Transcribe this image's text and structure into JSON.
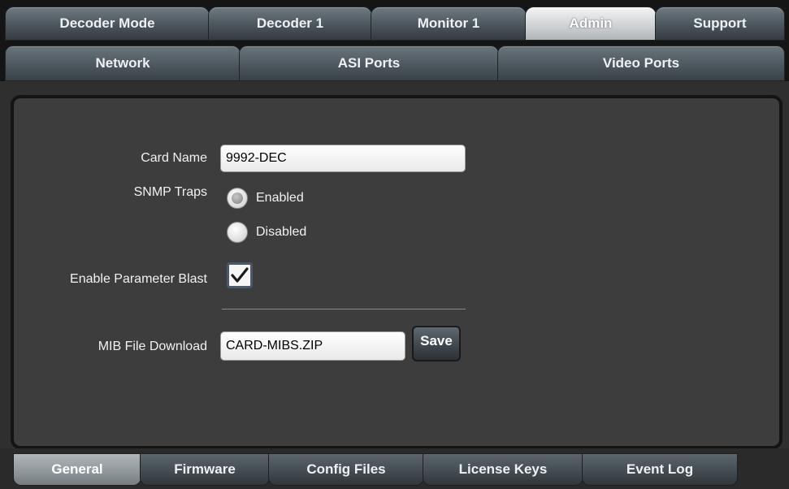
{
  "top_tabs": {
    "decoder_mode": "Decoder Mode",
    "decoder_1": "Decoder 1",
    "monitor_1": "Monitor 1",
    "admin": "Admin",
    "support": "Support"
  },
  "sub_tabs": {
    "network": "Network",
    "asi_ports": "ASI Ports",
    "video_ports": "Video Ports"
  },
  "form": {
    "card_name_label": "Card Name",
    "card_name_value": "9992-DEC",
    "snmp_traps_label": "SNMP Traps",
    "snmp_enabled_label": "Enabled",
    "snmp_disabled_label": "Disabled",
    "snmp_selected": "Enabled",
    "param_blast_label": "Enable Parameter Blast",
    "param_blast_checked": true,
    "mib_label": "MIB File Download",
    "mib_value": "CARD-MIBS.ZIP",
    "save_label": "Save"
  },
  "bottom_tabs": {
    "general": "General",
    "firmware": "Firmware",
    "config_files": "Config Files",
    "license_keys": "License Keys",
    "event_log": "Event Log"
  },
  "colors": {
    "background": "#2b2b2b",
    "panel": "#3d3d3d",
    "tab": "#4b555c",
    "active_tab": "#d0d4d6"
  }
}
